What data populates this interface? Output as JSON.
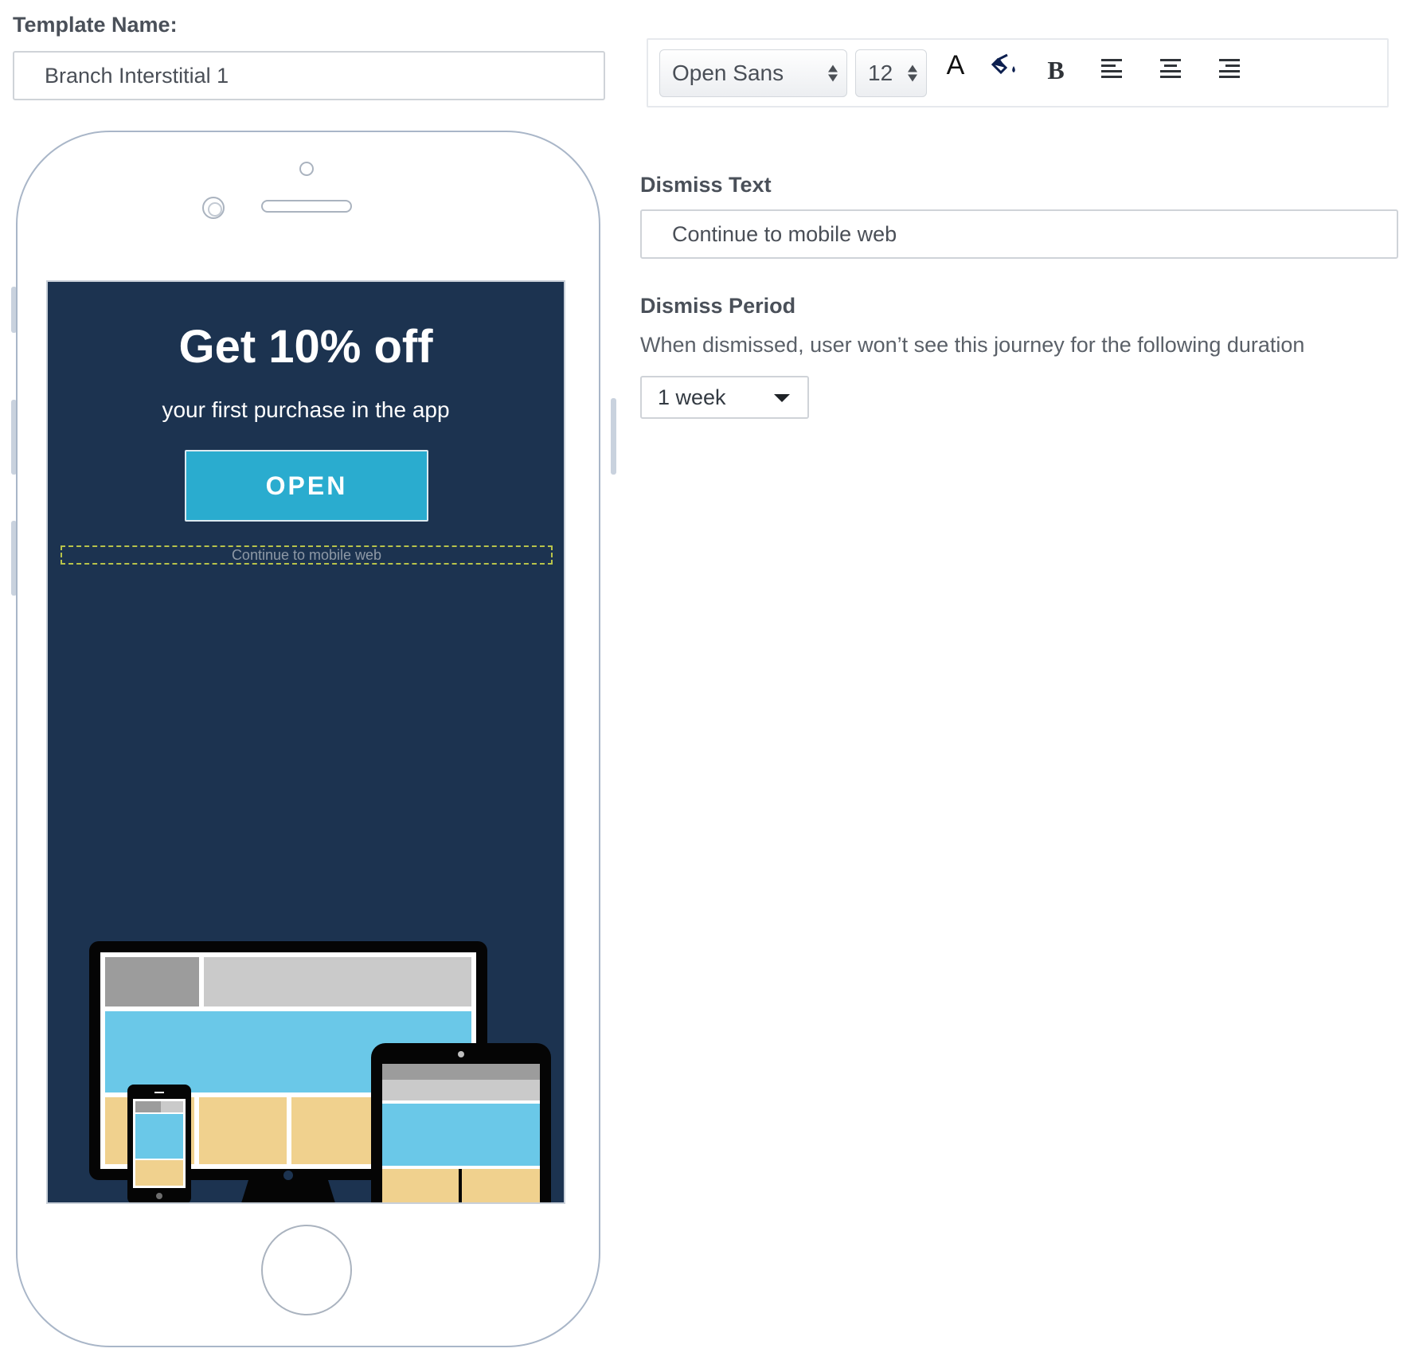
{
  "template": {
    "label": "Template Name:",
    "value": "Branch Interstitial 1"
  },
  "toolbar": {
    "font_family": "Open Sans",
    "font_size": "12",
    "text_color_glyph": "A",
    "bold_glyph": "B",
    "icons": [
      "text-color-icon",
      "fill-color-icon",
      "bold-icon",
      "align-left-icon",
      "align-center-icon",
      "align-right-icon"
    ]
  },
  "preview": {
    "title": "Get 10% off",
    "subtitle": "your first purchase in the app",
    "open_button": "OPEN",
    "dismiss_link": "Continue to mobile web",
    "colors": {
      "background": "#1c3350",
      "button": "#2aaccf",
      "illustration_blue": "#6ac8e8",
      "illustration_yellow": "#f0d18e",
      "illustration_gray_dark": "#9c9c9c",
      "illustration_gray_light": "#cacaca"
    }
  },
  "dismiss_text": {
    "label": "Dismiss Text",
    "value": "Continue to mobile web"
  },
  "dismiss_period": {
    "label": "Dismiss Period",
    "helper": "When dismissed, user won’t see this journey for the following duration",
    "selected": "1 week"
  }
}
